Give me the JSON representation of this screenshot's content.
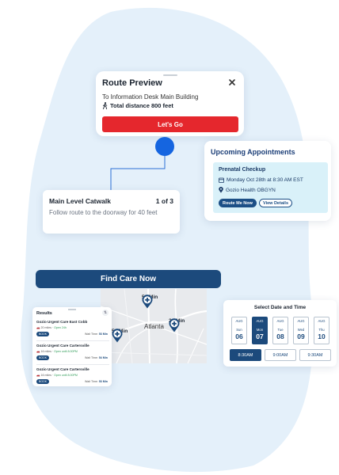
{
  "route_preview": {
    "title": "Route Preview",
    "destination": "To Information Desk Main Building",
    "distance": "Total distance 800 feet",
    "go_label": "Let's Go"
  },
  "step": {
    "title": "Main Level Catwalk",
    "count": "1 of 3",
    "description": "Follow route to the doorway for 40 feet"
  },
  "appointments": {
    "title": "Upcoming Appointments",
    "item": {
      "name": "Prenatal Checkup",
      "datetime": "Monday Oct 28th at 8:30 AM EST",
      "location": "Gozio Health OBGYN",
      "route_label": "Route Me Now",
      "details_label": "View Details"
    }
  },
  "find_care": {
    "label": "Find Care Now"
  },
  "map": {
    "city": "Atlanta",
    "pins": [
      "53 Min",
      "20 Min",
      "54 Min"
    ]
  },
  "results": {
    "title": "Results",
    "sort_icon": "⇅",
    "items": [
      {
        "name": "Gozio Urgent Care East Cobb",
        "distance": "20 miles",
        "status": "Open 24h",
        "book": "BOOK",
        "wait_label": "Wait Time:",
        "wait": "53 Min"
      },
      {
        "name": "Gozio Urgent Care Cartersville",
        "distance": "16 miles",
        "status": "Open until 8:00PM",
        "book": "BOOK",
        "wait_label": "Wait Time:",
        "wait": "54 Min"
      },
      {
        "name": "Gozio Urgent Care Cartersville",
        "distance": "16 miles",
        "status": "Open until 8:00PM",
        "book": "BOOK",
        "wait_label": "Wait Time:",
        "wait": "53 Min"
      }
    ]
  },
  "date_picker": {
    "title": "Select Date and Time",
    "days": [
      {
        "month": "AUG",
        "day": "Sun",
        "num": "06"
      },
      {
        "month": "AUG",
        "day": "Mon",
        "num": "07"
      },
      {
        "month": "AUG",
        "day": "Tue",
        "num": "08"
      },
      {
        "month": "AUG",
        "day": "Wed",
        "num": "09"
      },
      {
        "month": "AUG",
        "day": "Thu",
        "num": "10"
      }
    ],
    "times": [
      "8:30AM",
      "9:00AM",
      "9:30AM"
    ]
  },
  "colors": {
    "blob": "#e4f0fa",
    "brand_navy": "#1c4a7c",
    "go_red": "#e5272d",
    "route_blue": "#1565e0",
    "appointment_bg": "#d9f1f9"
  },
  "icons": [
    "close-icon",
    "walking-icon",
    "calendar-icon",
    "location-pin-icon",
    "map-pin-icon",
    "sort-icon",
    "car-icon"
  ]
}
